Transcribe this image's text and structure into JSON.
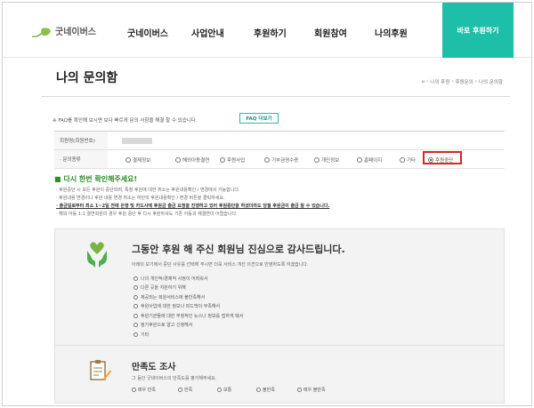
{
  "header": {
    "logo_text": "굿네이버스",
    "nav": [
      "굿네이버스",
      "사업안내",
      "후원하기",
      "회원참여",
      "나의후원"
    ],
    "cta_label": "바로 후원하기"
  },
  "page": {
    "title": "나의 문의함",
    "breadcrumb": [
      "나의 후원",
      "후원문의",
      "나의 문의함"
    ]
  },
  "faq": {
    "text": "※ FAQ를 확인해 보시면 보다 빠르게 문의 사항을 해결 할 수 있습니다.",
    "button_label": "FAQ 더보기"
  },
  "form": {
    "name_label": "회원명(회원번호)",
    "type_label": "· 문의종류",
    "options": [
      "결제정보",
      "해외아동결연",
      "후원사업",
      "기부금영수증",
      "개인정보",
      "홈페이지",
      "기타",
      "후원중단"
    ],
    "selected": "후원중단"
  },
  "notice": {
    "title": "다시 한번 확인해주세요!",
    "items": [
      "· 후원중단 시 모든 후원이 중단되며, 특정 후원에 대한 취소는 후원내용확인 / 변경에서 가능합니다.",
      "· 후원내용 변경이나 후원 내용 변경 취소는 하단의 후원내용확인 / 변경 버튼을 클릭하세요.",
      "· 출금일로부터 최소 1~2일 전에 은행 및 카드사에 후원금 출금 요청을 진행하고 있어 후원중단을 하셨더라도 당월 후원금이 출금 될 수 있습니다.",
      "· 해외 아동 1:1 결연회원의 경우 후원 중단 후 다시 후원하셔도 기존 아동과 재결연이 어렵습니다."
    ]
  },
  "thanks": {
    "title": "그동안 후원 해 주신 회원님 진심으로 감사드립니다.",
    "subtitle": "아래의 보기에서 중단 사유를 선택해 주시면 더욱 서비스 개선 의견으로 반영하도록 하겠습니다.",
    "reasons": [
      "나의 개인적/경제적 사정이 어려워서",
      "다른 곳을 지원하기 위해",
      "제공되는 회원서비스에 불만족해서",
      "후원사업에 대한 정보나 피드백이 부족해서",
      "후원기관들에 대한 부정적인 뉴스나 정보를 접하게 돼서",
      "정기후원으로 알고 신청해서",
      "기타"
    ]
  },
  "survey": {
    "title": "만족도 조사",
    "subtitle": "그 동안 굿네이버스의 만족도를 평가해주세요.",
    "ratings": [
      "매우 만족",
      "만족",
      "보통",
      "불만족",
      "매우 불만족"
    ]
  },
  "colors": {
    "brand": "#1ebfa8",
    "highlight": "#d6262a",
    "notice": "#2a8f2a"
  }
}
